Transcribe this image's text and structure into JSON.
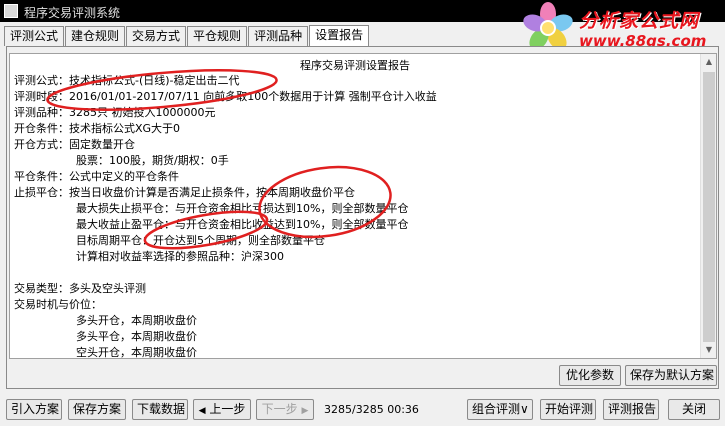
{
  "window": {
    "title": "程序交易评测系统"
  },
  "logo": {
    "brand": "分析家公式网",
    "url": "www.88gs.com"
  },
  "tabs": [
    "评测公式",
    "建仓规则",
    "交易方式",
    "平仓规则",
    "评测品种",
    "设置报告"
  ],
  "report": {
    "title": "程序交易评测设置报告",
    "lines": [
      {
        "text": "评测公式：技术指标公式-(日线)-稳定出击二代",
        "indent": false
      },
      {
        "text": "评测时段：2016/01/01-2017/07/11 向前多取100个数据用于计算 强制平仓计入收益",
        "indent": false
      },
      {
        "text": "评测品种：3285只 初始投入1000000元",
        "indent": false
      },
      {
        "text": "开仓条件：技术指标公式XG大于0",
        "indent": false
      },
      {
        "text": "开仓方式：固定数量开仓",
        "indent": false
      },
      {
        "text": "股票：100股，期货/期权：0手",
        "indent": true
      },
      {
        "text": "平仓条件：公式中定义的平仓条件",
        "indent": false
      },
      {
        "text": "止损平仓：按当日收盘价计算是否满足止损条件，按本周期收盘价平仓",
        "indent": false
      },
      {
        "text": "最大损失止损平仓：与开仓资金相比亏损达到10%，则全部数量平仓",
        "indent": true
      },
      {
        "text": "最大收益止盈平仓：与开仓资金相比收益达到10%，则全部数量平仓",
        "indent": true
      },
      {
        "text": "目标周期平仓：开仓达到5个周期，则全部数量平仓",
        "indent": true
      },
      {
        "text": "计算相对收益率选择的参照品种：沪深300",
        "indent": true
      },
      {
        "text": "",
        "indent": false
      },
      {
        "text": "交易类型：多头及空头评测",
        "indent": false
      },
      {
        "text": "交易时机与价位：",
        "indent": false
      },
      {
        "text": "多头开仓，本周期收盘价",
        "indent": true
      },
      {
        "text": "多头平仓，本周期收盘价",
        "indent": true
      },
      {
        "text": "空头开仓，本周期收盘价",
        "indent": true
      }
    ]
  },
  "panel_buttons": {
    "optimize": "优化参数",
    "save_default": "保存为默认方案"
  },
  "bottom_buttons": {
    "import": "引入方案",
    "save": "保存方案",
    "download": "下载数据",
    "prev": "上一步",
    "next": "下一步",
    "combine": "组合评测",
    "start": "开始评测",
    "report": "评测报告",
    "close": "关闭"
  },
  "status": {
    "progress": "3285/3285",
    "time": "00:36"
  },
  "colors": {
    "annotation": "#e02020",
    "logo": "#e8161e",
    "titlebar": "#000000"
  },
  "icons": {
    "prev": "◀",
    "next": "▶",
    "dropdown": "∨"
  }
}
